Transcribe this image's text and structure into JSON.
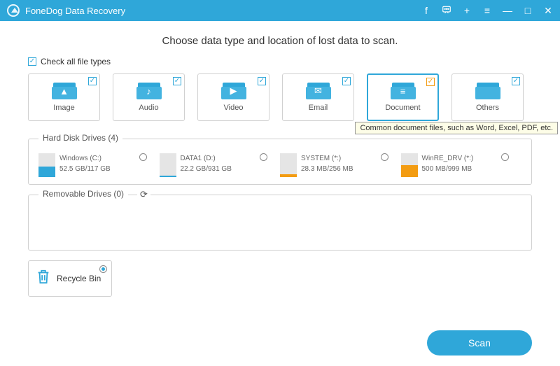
{
  "app": {
    "title": "FoneDog Data Recovery"
  },
  "heading": "Choose data type and location of lost data to scan.",
  "checkAllLabel": "Check all file types",
  "types": [
    {
      "label": "Image",
      "glyph": "▲",
      "checked": true,
      "active": false
    },
    {
      "label": "Audio",
      "glyph": "♪",
      "checked": true,
      "active": false
    },
    {
      "label": "Video",
      "glyph": "▶",
      "checked": true,
      "active": false
    },
    {
      "label": "Email",
      "glyph": "✉",
      "checked": true,
      "active": false
    },
    {
      "label": "Document",
      "glyph": "≡",
      "checked": true,
      "active": true,
      "checkColor": "orange"
    },
    {
      "label": "Others",
      "glyph": "",
      "checked": true,
      "active": false
    }
  ],
  "tooltip": "Common document files, such as Word, Excel, PDF, etc.",
  "hardDisk": {
    "legend": "Hard Disk Drives (4)",
    "drives": [
      {
        "name": "Windows (C:)",
        "size": "52.5 GB/117 GB",
        "usedPct": 45,
        "color": "blue"
      },
      {
        "name": "DATA1 (D:)",
        "size": "22.2 GB/931 GB",
        "usedPct": 3,
        "color": "blue"
      },
      {
        "name": "SYSTEM (*:)",
        "size": "28.3 MB/256 MB",
        "usedPct": 12,
        "color": "orange"
      },
      {
        "name": "WinRE_DRV (*:)",
        "size": "500 MB/999 MB",
        "usedPct": 50,
        "color": "orange"
      }
    ]
  },
  "removable": {
    "legend": "Removable Drives (0)"
  },
  "recycleBin": {
    "label": "Recycle Bin",
    "selected": true
  },
  "scanLabel": "Scan"
}
